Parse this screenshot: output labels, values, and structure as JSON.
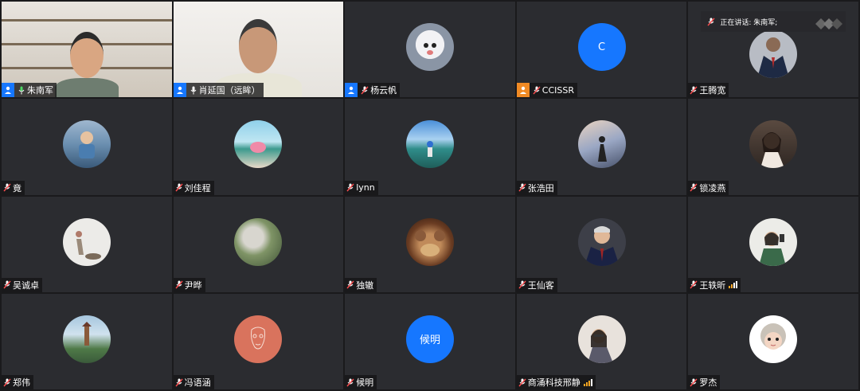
{
  "speaking_banner": {
    "text": "正在讲话: 朱南军;"
  },
  "colors": {
    "tile_bg": "#2b2c30",
    "accent_blue": "#1677ff",
    "host_orange": "#f08a24",
    "signal_orange": "#f5a623",
    "avatar_coral": "#d9735d"
  },
  "participants": [
    {
      "name": "朱南军",
      "type": "video",
      "badge": "host-blue",
      "mic": "on"
    },
    {
      "name": "肖延国（远眸）",
      "type": "video",
      "badge": "host-blue",
      "mic": "on"
    },
    {
      "name": "杨云帆",
      "type": "photo",
      "badge": "host-blue",
      "mic": "muted",
      "icon": "toy-photo"
    },
    {
      "name": "CCISSR",
      "type": "letter",
      "avatar_text": "C",
      "badge": "host-orange",
      "mic": "muted"
    },
    {
      "name": "王腾宽",
      "type": "photo",
      "mic": "muted",
      "icon": "suit-photo"
    },
    {
      "name": "竟",
      "type": "photo",
      "mic": "muted",
      "icon": "child-photo"
    },
    {
      "name": "刘佳程",
      "type": "photo",
      "mic": "muted",
      "icon": "lake-photo"
    },
    {
      "name": "lynn",
      "type": "photo",
      "mic": "muted",
      "icon": "lake-person-photo"
    },
    {
      "name": "张浩田",
      "type": "photo",
      "mic": "muted",
      "icon": "silhouette-photo"
    },
    {
      "name": "锁凌燕",
      "type": "photo",
      "mic": "muted",
      "icon": "woman-photo"
    },
    {
      "name": "吴诚卓",
      "type": "photo",
      "mic": "muted",
      "icon": "walking-photo"
    },
    {
      "name": "尹晔",
      "type": "photo",
      "mic": "muted",
      "icon": "landscape-photo"
    },
    {
      "name": "独辙",
      "type": "photo",
      "mic": "muted",
      "icon": "bears-photo"
    },
    {
      "name": "王仙客",
      "type": "photo",
      "mic": "muted",
      "icon": "man-suit-photo"
    },
    {
      "name": "王轶昕",
      "type": "photo",
      "mic": "muted",
      "icon": "selfie-photo",
      "signal": true
    },
    {
      "name": "郑伟",
      "type": "photo",
      "mic": "muted",
      "icon": "pagoda-photo"
    },
    {
      "name": "冯语涵",
      "type": "photo",
      "mic": "muted",
      "icon": "sketch-photo"
    },
    {
      "name": "候明",
      "type": "text",
      "avatar_text": "候明",
      "mic": "muted"
    },
    {
      "name": "商涌科技邢静",
      "type": "photo",
      "mic": "muted",
      "icon": "woman-glasses-photo",
      "signal": true
    },
    {
      "name": "罗杰",
      "type": "photo",
      "mic": "muted",
      "icon": "cartoon-grandma-photo"
    }
  ]
}
